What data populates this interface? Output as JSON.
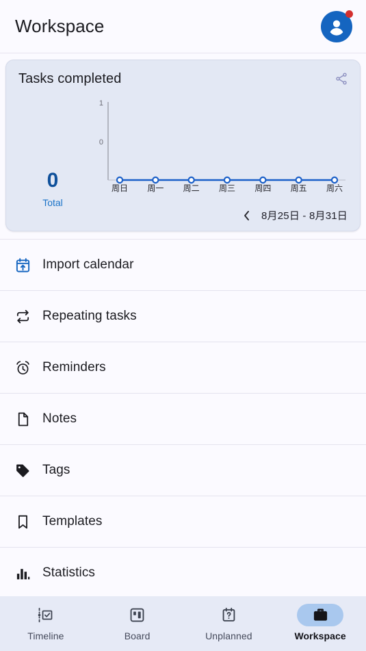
{
  "header": {
    "title": "Workspace",
    "avatar_icon": "account-circle-icon",
    "has_notification_badge": true
  },
  "card": {
    "title": "Tasks completed",
    "share_icon": "share-icon",
    "total_value": "0",
    "total_label": "Total",
    "prev_icon": "chevron-left-icon",
    "date_range": "8月25日 - 8月31日"
  },
  "chart_data": {
    "type": "line",
    "title": "Tasks completed",
    "categories": [
      "周日",
      "周一",
      "周二",
      "周三",
      "周四",
      "周五",
      "周六"
    ],
    "values": [
      0,
      0,
      0,
      0,
      0,
      0,
      0
    ],
    "yticks": [
      "1",
      "0"
    ],
    "ylim": [
      0,
      1
    ],
    "xlabel": "",
    "ylabel": "",
    "grid": false,
    "legend": "none",
    "line_color": "#1a5fc8",
    "marker_fill": "#ffffff",
    "marker_stroke": "#1a5fc8"
  },
  "list": {
    "items": [
      {
        "label": "Import calendar",
        "icon": "calendar-import-icon",
        "accent": true
      },
      {
        "label": "Repeating tasks",
        "icon": "repeat-icon",
        "accent": false
      },
      {
        "label": "Reminders",
        "icon": "alarm-clock-icon",
        "accent": false
      },
      {
        "label": "Notes",
        "icon": "note-icon",
        "accent": false
      },
      {
        "label": "Tags",
        "icon": "tag-icon",
        "accent": false
      },
      {
        "label": "Templates",
        "icon": "bookmark-icon",
        "accent": false
      },
      {
        "label": "Statistics",
        "icon": "bar-chart-icon",
        "accent": false
      }
    ]
  },
  "bottom_nav": {
    "active": "Workspace",
    "items": [
      {
        "label": "Timeline",
        "icon": "timeline-icon"
      },
      {
        "label": "Board",
        "icon": "board-icon"
      },
      {
        "label": "Unplanned",
        "icon": "unplanned-calendar-icon"
      },
      {
        "label": "Workspace",
        "icon": "briefcase-icon"
      }
    ]
  },
  "colors": {
    "accent": "#1565c0",
    "card_bg": "#e3e8f4",
    "page_bg": "#fbfaff",
    "nav_bg": "#e6eaf6",
    "nav_pill": "#a9c8ee",
    "badge": "#d3302f"
  }
}
